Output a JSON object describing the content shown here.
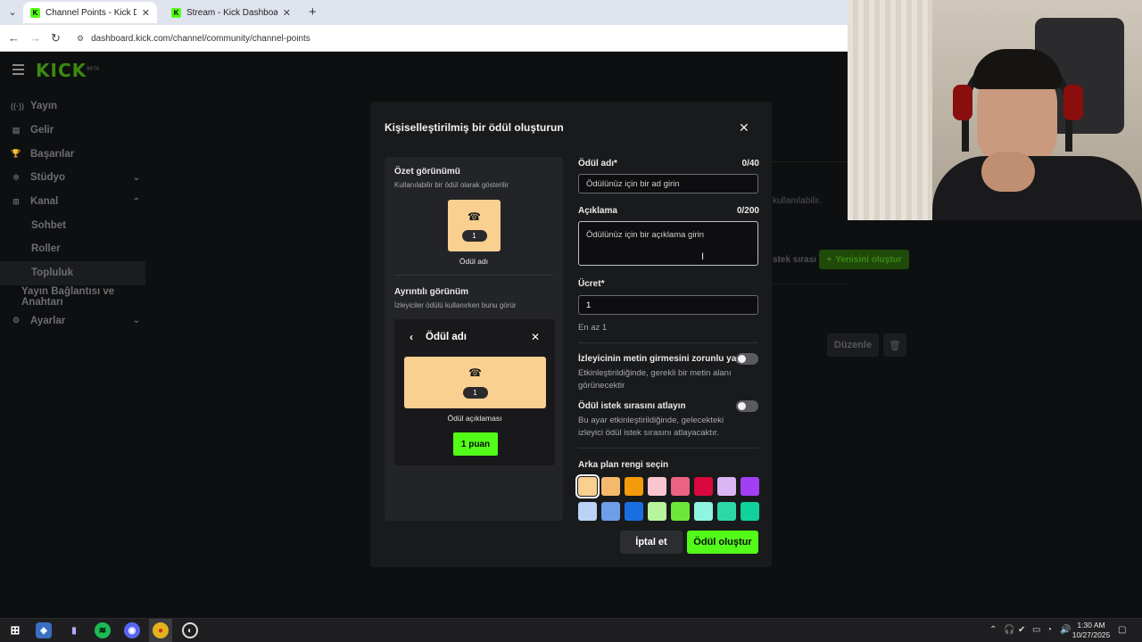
{
  "browser": {
    "tabs": [
      {
        "label": "Channel Points - Kick Dashboard",
        "active": true
      },
      {
        "label": "Stream - Kick Dashboard",
        "active": false
      }
    ],
    "new_tab": "+",
    "url": "dashboard.kick.com/channel/community/channel-points"
  },
  "app": {
    "logo": "KICK",
    "logo_badge": "BETA",
    "sidebar": [
      {
        "label": "Yayın",
        "icon": "broadcast-icon"
      },
      {
        "label": "Gelir",
        "icon": "revenue-icon"
      },
      {
        "label": "Başarılar",
        "icon": "trophy-icon"
      },
      {
        "label": "Stüdyo",
        "icon": "studio-icon",
        "chevron": "down"
      },
      {
        "label": "Kanal",
        "icon": "channel-icon",
        "chevron": "up"
      },
      {
        "label": "Sohbet"
      },
      {
        "label": "Roller"
      },
      {
        "label": "Topluluk",
        "selected": true
      },
      {
        "label": "Yayın Bağlantısı ve Anahtarı"
      },
      {
        "label": "Ayarlar",
        "icon": "settings-icon",
        "chevron": "down"
      }
    ],
    "background": {
      "description_fragment": "kullanılabilir.",
      "queue_fragment": "stek sırası",
      "create_new": "Yenisini oluştur",
      "edit": "Düzenle"
    }
  },
  "modal": {
    "title": "Kişiselleştirilmiş bir ödül oluşturun",
    "preview": {
      "summary_title": "Özet görünümü",
      "summary_sub": "Kullanılabilir bir ödül olarak gösterilir",
      "cost": "1",
      "reward_name": "Ödül adı",
      "detail_title": "Ayrıntılı görünüm",
      "detail_sub": "İzleyiciler ödülü kullanırken bunu görür",
      "detail_header": "Ödül adı",
      "detail_desc": "Ödül açıklaması",
      "points_button": "1 puan"
    },
    "form": {
      "name_label": "Ödül adı*",
      "name_count": "0/40",
      "name_placeholder": "Ödülünüz için bir ad girin",
      "desc_label": "Açıklama",
      "desc_count": "0/200",
      "desc_placeholder": "Ödülünüz için bir açıklama girin",
      "cost_label": "Ücret*",
      "cost_value": "1",
      "cost_hint": "En az 1",
      "toggle1_label": "İzleyicinin metin girmesini zorunlu yap",
      "toggle1_desc": "Etkinleştirildiğinde, gerekli bir metin alanı görünecektir",
      "toggle1_on": false,
      "toggle2_label": "Ödül istek sırasını atlayın",
      "toggle2_desc": "Bu ayar etkinleştirildiğinde, gelecekteki izleyici ödül istek sırasını atlayacaktır.",
      "toggle2_on": false,
      "color_title": "Arka plan rengi seçin",
      "colors": [
        "#f9d08f",
        "#f5b96b",
        "#f59b0b",
        "#f9c6cf",
        "#ea6482",
        "#d9083f",
        "#d9b6f3",
        "#a23ff5",
        "#b9d2f5",
        "#6d9ee8",
        "#1a6fe0",
        "#b6f59c",
        "#6de83a",
        "#8ff5e1",
        "#2cd9a6",
        "#10d29a"
      ],
      "selected_color_index": 0
    },
    "buttons": {
      "cancel": "İptal et",
      "submit": "Ödül oluştur"
    }
  },
  "taskbar": {
    "time": "1:30 AM",
    "date": "10/27/2025"
  }
}
